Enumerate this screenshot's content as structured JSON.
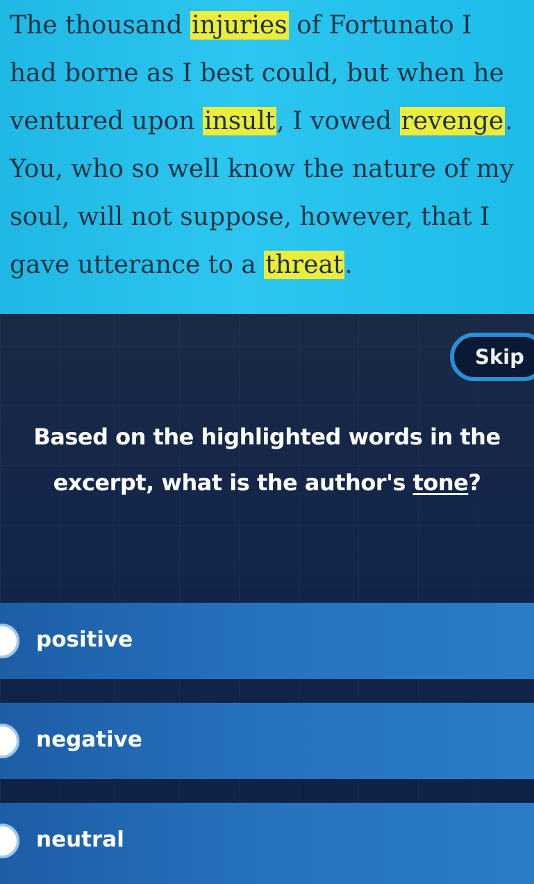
{
  "passage": {
    "seg1": "The thousand ",
    "hl1": "injuries",
    "seg2": " of Fortunato I had borne as I best could, but when he ventured upon ",
    "hl2": "insult",
    "seg3": ", I vowed ",
    "hl3": "revenge",
    "seg4": ". You, who so well know the nature of my soul, will not suppose, however, that I gave utterance to a ",
    "hl4": "threat",
    "seg5": "."
  },
  "skip_label": "Skip",
  "question": {
    "before": "Based on the highlighted words in the excerpt, what is the author's ",
    "underlined": "tone",
    "after": "?"
  },
  "options": [
    {
      "label": "positive"
    },
    {
      "label": "negative"
    },
    {
      "label": "neutral"
    }
  ],
  "colors": {
    "passage_bg": "#2cc6f0",
    "highlight": "#ecec3c",
    "panel_bg": "#13254a",
    "option_bg": "#2672bf",
    "skip_border": "#2b8fd8"
  }
}
